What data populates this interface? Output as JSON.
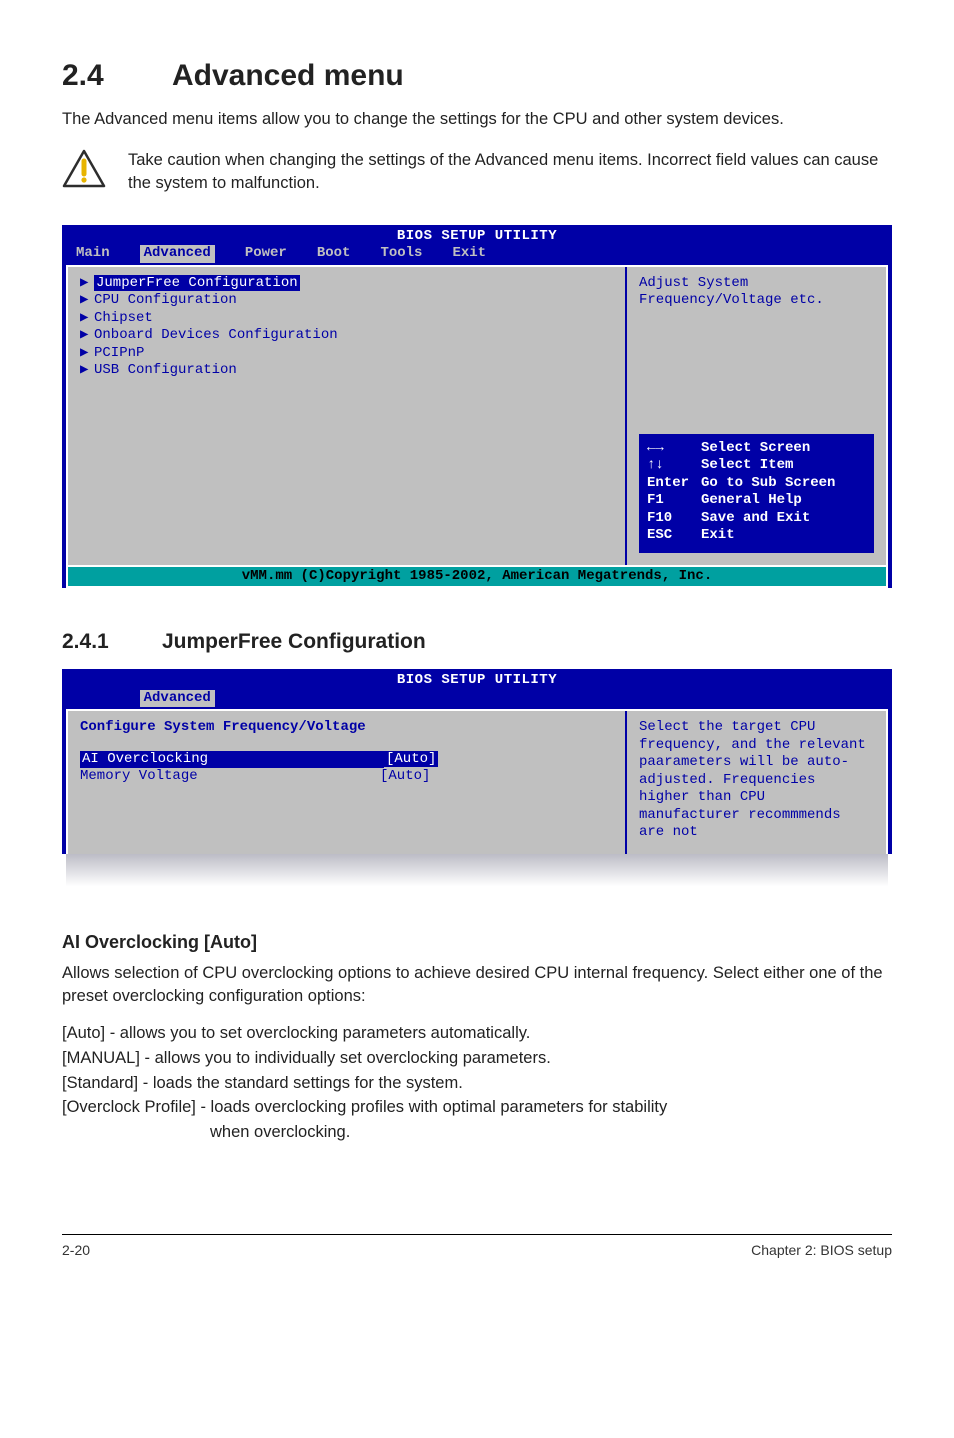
{
  "heading": {
    "num": "2.4",
    "title": "Advanced menu"
  },
  "intro": "The Advanced menu items allow you to change the settings for the CPU and other system devices.",
  "caution": "Take caution when changing the settings of the Advanced menu items. Incorrect field values can cause the system to malfunction.",
  "bios1": {
    "title": "BIOS SETUP UTILITY",
    "tabs": [
      "Main",
      "Advanced",
      "Power",
      "Boot",
      "Tools",
      "Exit"
    ],
    "selectedTab": "Advanced",
    "items": [
      "JumperFree Configuration",
      "CPU Configuration",
      "Chipset",
      "Onboard Devices Configuration",
      "PCIPnP",
      "USB Configuration"
    ],
    "highlighted": "JumperFree Configuration",
    "help": "Adjust System Frequency/Voltage etc.",
    "keys": [
      {
        "k": "←→",
        "d": "Select Screen"
      },
      {
        "k": "↑↓",
        "d": "Select Item"
      },
      {
        "k": "Enter",
        "d": "Go to Sub Screen"
      },
      {
        "k": "F1",
        "d": "General Help"
      },
      {
        "k": "F10",
        "d": "Save and Exit"
      },
      {
        "k": "ESC",
        "d": "Exit"
      }
    ],
    "footer": "vMM.mm (C)Copyright 1985-2002, American Megatrends, Inc."
  },
  "sub1": {
    "num": "2.4.1",
    "title": "JumperFree Configuration"
  },
  "bios2": {
    "title": "BIOS SETUP UTILITY",
    "selectedTab": "Advanced",
    "header": "Configure System Frequency/Voltage",
    "rows": [
      {
        "label": "AI Overclocking",
        "value": "[Auto]",
        "hl": true
      },
      {
        "label": "Memory Voltage",
        "value": "[Auto]",
        "hl": false
      }
    ],
    "help": "Select the target CPU frequency, and the relevant paarameters will be auto-adjusted. Frequencies higher than CPU manufacturer recommmends are not"
  },
  "ai": {
    "heading": "AI Overclocking [Auto]",
    "desc": "Allows selection of CPU overclocking options to achieve desired CPU internal frequency. Select either one of the preset overclocking configuration options:",
    "opts": {
      "auto": {
        "k": "[Auto]",
        "d": "- allows you to set overclocking parameters automatically."
      },
      "manual": {
        "k": "[MANUAL]",
        "d": "- allows you to individually set overclocking parameters."
      },
      "standard": {
        "k": "[Standard]",
        "d": "- loads the standard settings for the system."
      },
      "ocprofile": {
        "k": "[Overclock Profile]",
        "d": "- loads overclocking profiles with optimal parameters for stability when overclocking."
      }
    }
  },
  "footer": {
    "left": "2-20",
    "right": "Chapter 2: BIOS setup"
  }
}
